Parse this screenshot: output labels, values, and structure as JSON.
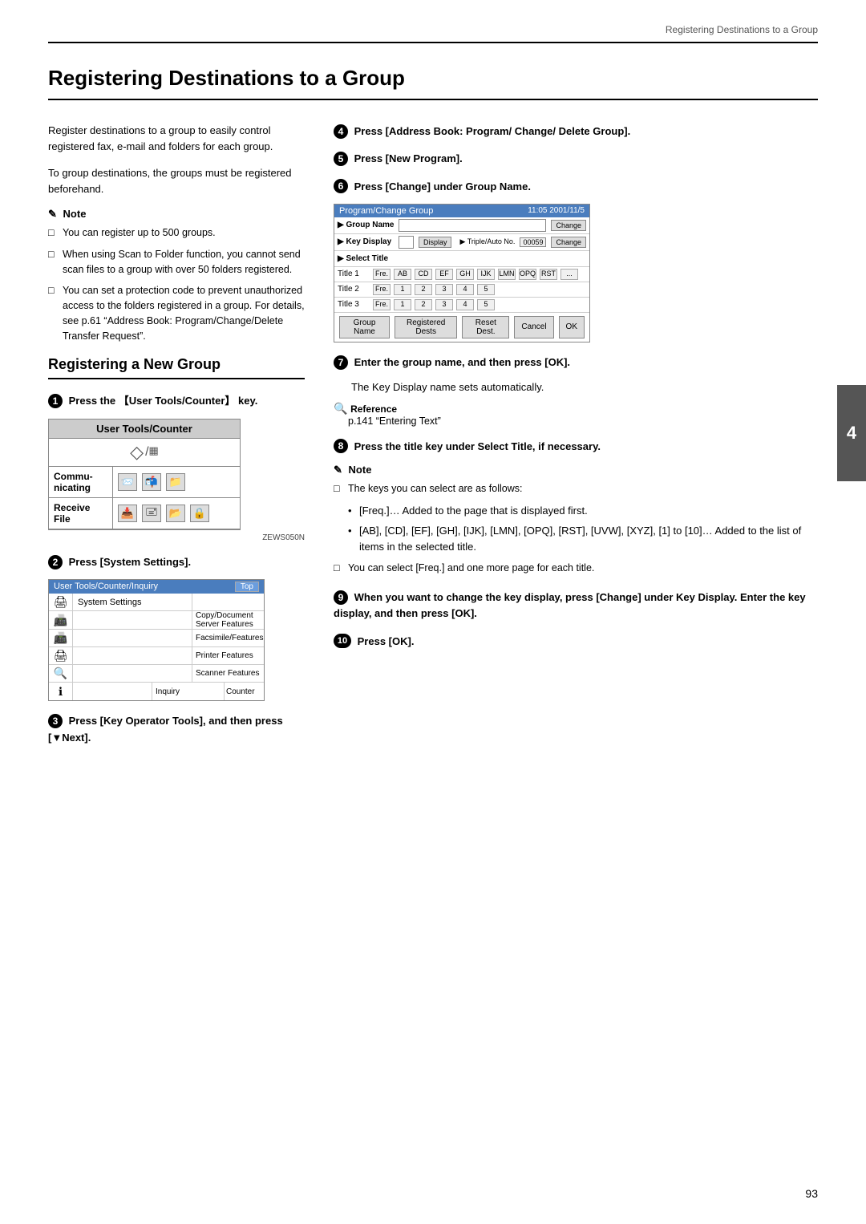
{
  "header": {
    "title": "Registering Destinations to a Group"
  },
  "page_title": "Registering Destinations to a Group",
  "intro": {
    "para1": "Register destinations to a group to easily control registered fax, e-mail and folders for each group.",
    "para2": "To group destinations, the groups must be registered beforehand."
  },
  "note_section": {
    "title": "Note",
    "items": [
      "You can register up to 500 groups.",
      "When using Scan to Folder function, you cannot send scan files to a group with over 50 folders registered.",
      "You can set a protection code to prevent unauthorized access to the folders registered in a group. For details, see p.61 “Address Book: Program/Change/Delete Transfer Request”."
    ]
  },
  "section_heading": "Registering a New Group",
  "steps_left": [
    {
      "number": "1",
      "text": "Press the 【User Tools/Counter】 key."
    },
    {
      "number": "2",
      "text": "Press [System Settings]."
    },
    {
      "number": "3",
      "text": "Press [Key Operator Tools], and then press [▼Next]."
    }
  ],
  "steps_right": [
    {
      "number": "4",
      "text": "Press [Address Book: Program/ Change/ Delete Group]."
    },
    {
      "number": "5",
      "text": "Press [New Program]."
    },
    {
      "number": "6",
      "text": "Press  [Change]  under  Group Name."
    },
    {
      "number": "7",
      "text": "Enter the group name, and then press [OK].",
      "body": "The Key Display name sets automatically."
    },
    {
      "number": "8",
      "text": "Press the title key under Select Title, if necessary."
    },
    {
      "number": "9",
      "text": "When you want to change the key display, press [Change] under Key Display. Enter the key display, and then press [OK]."
    },
    {
      "number": "10",
      "text": "Press [OK]."
    }
  ],
  "reference": {
    "title": "Reference",
    "text": "p.141 “Entering Text”"
  },
  "note_section2": {
    "title": "Note",
    "items": [
      "The keys you can select are as follows:",
      "You can select [Freq.] and one more page for each title."
    ]
  },
  "bullet_items": [
    "[Freq.]… Added to the page that is displayed first.",
    "[AB], [CD], [EF], [GH], [IJK], [LMN], [OPQ], [RST], [UVW], [XYZ], [1] to [10]… Added to the list of items in the selected title."
  ],
  "ui_utc": {
    "title": "User Tools/Counter",
    "commu_label": "Commu-\nnicating",
    "receive_label": "Receive\nFile",
    "caption": "ZEWS050N"
  },
  "ui_uti": {
    "title": "User Tools/Counter/Inquiry",
    "btn": "Top",
    "rows": [
      {
        "icon": "🖨",
        "label": "System Settings",
        "extra": ""
      },
      {
        "icon": "📠",
        "label": "",
        "extra": "Copy/Document Server Features"
      },
      {
        "icon": "📠",
        "label": "",
        "extra": "Facsimile/Features"
      },
      {
        "icon": "🖨",
        "label": "",
        "extra": "Printer Features"
      },
      {
        "icon": "🔍",
        "label": "",
        "extra": "Scanner Features"
      },
      {
        "icon": "ℹ",
        "label": "",
        "extra": "Inquiry"
      },
      {
        "icon": "💬",
        "label": "",
        "extra": "Counter"
      }
    ]
  },
  "ui_pcg": {
    "title": "Program/Change Group",
    "group_name_label": "▶ Group Name",
    "key_display_label": "▶ Key Display",
    "select_title_label": "▶ Select Title",
    "title1_label": "Title 1",
    "title2_label": "Title 2",
    "title3_label": "Title 3",
    "change_btn": "Change",
    "display_btn": "Display",
    "fre_label": "Fre.",
    "number": "00059",
    "title_cells": [
      "AB",
      "CD",
      "EF",
      "GH",
      "IJK",
      "LMN",
      "OPQ",
      "RST",
      "..."
    ],
    "footer_btns": [
      "Group Name",
      "Registered Dests",
      "Reset Dest.",
      "Cancel",
      "OK"
    ]
  },
  "page_number": "93"
}
